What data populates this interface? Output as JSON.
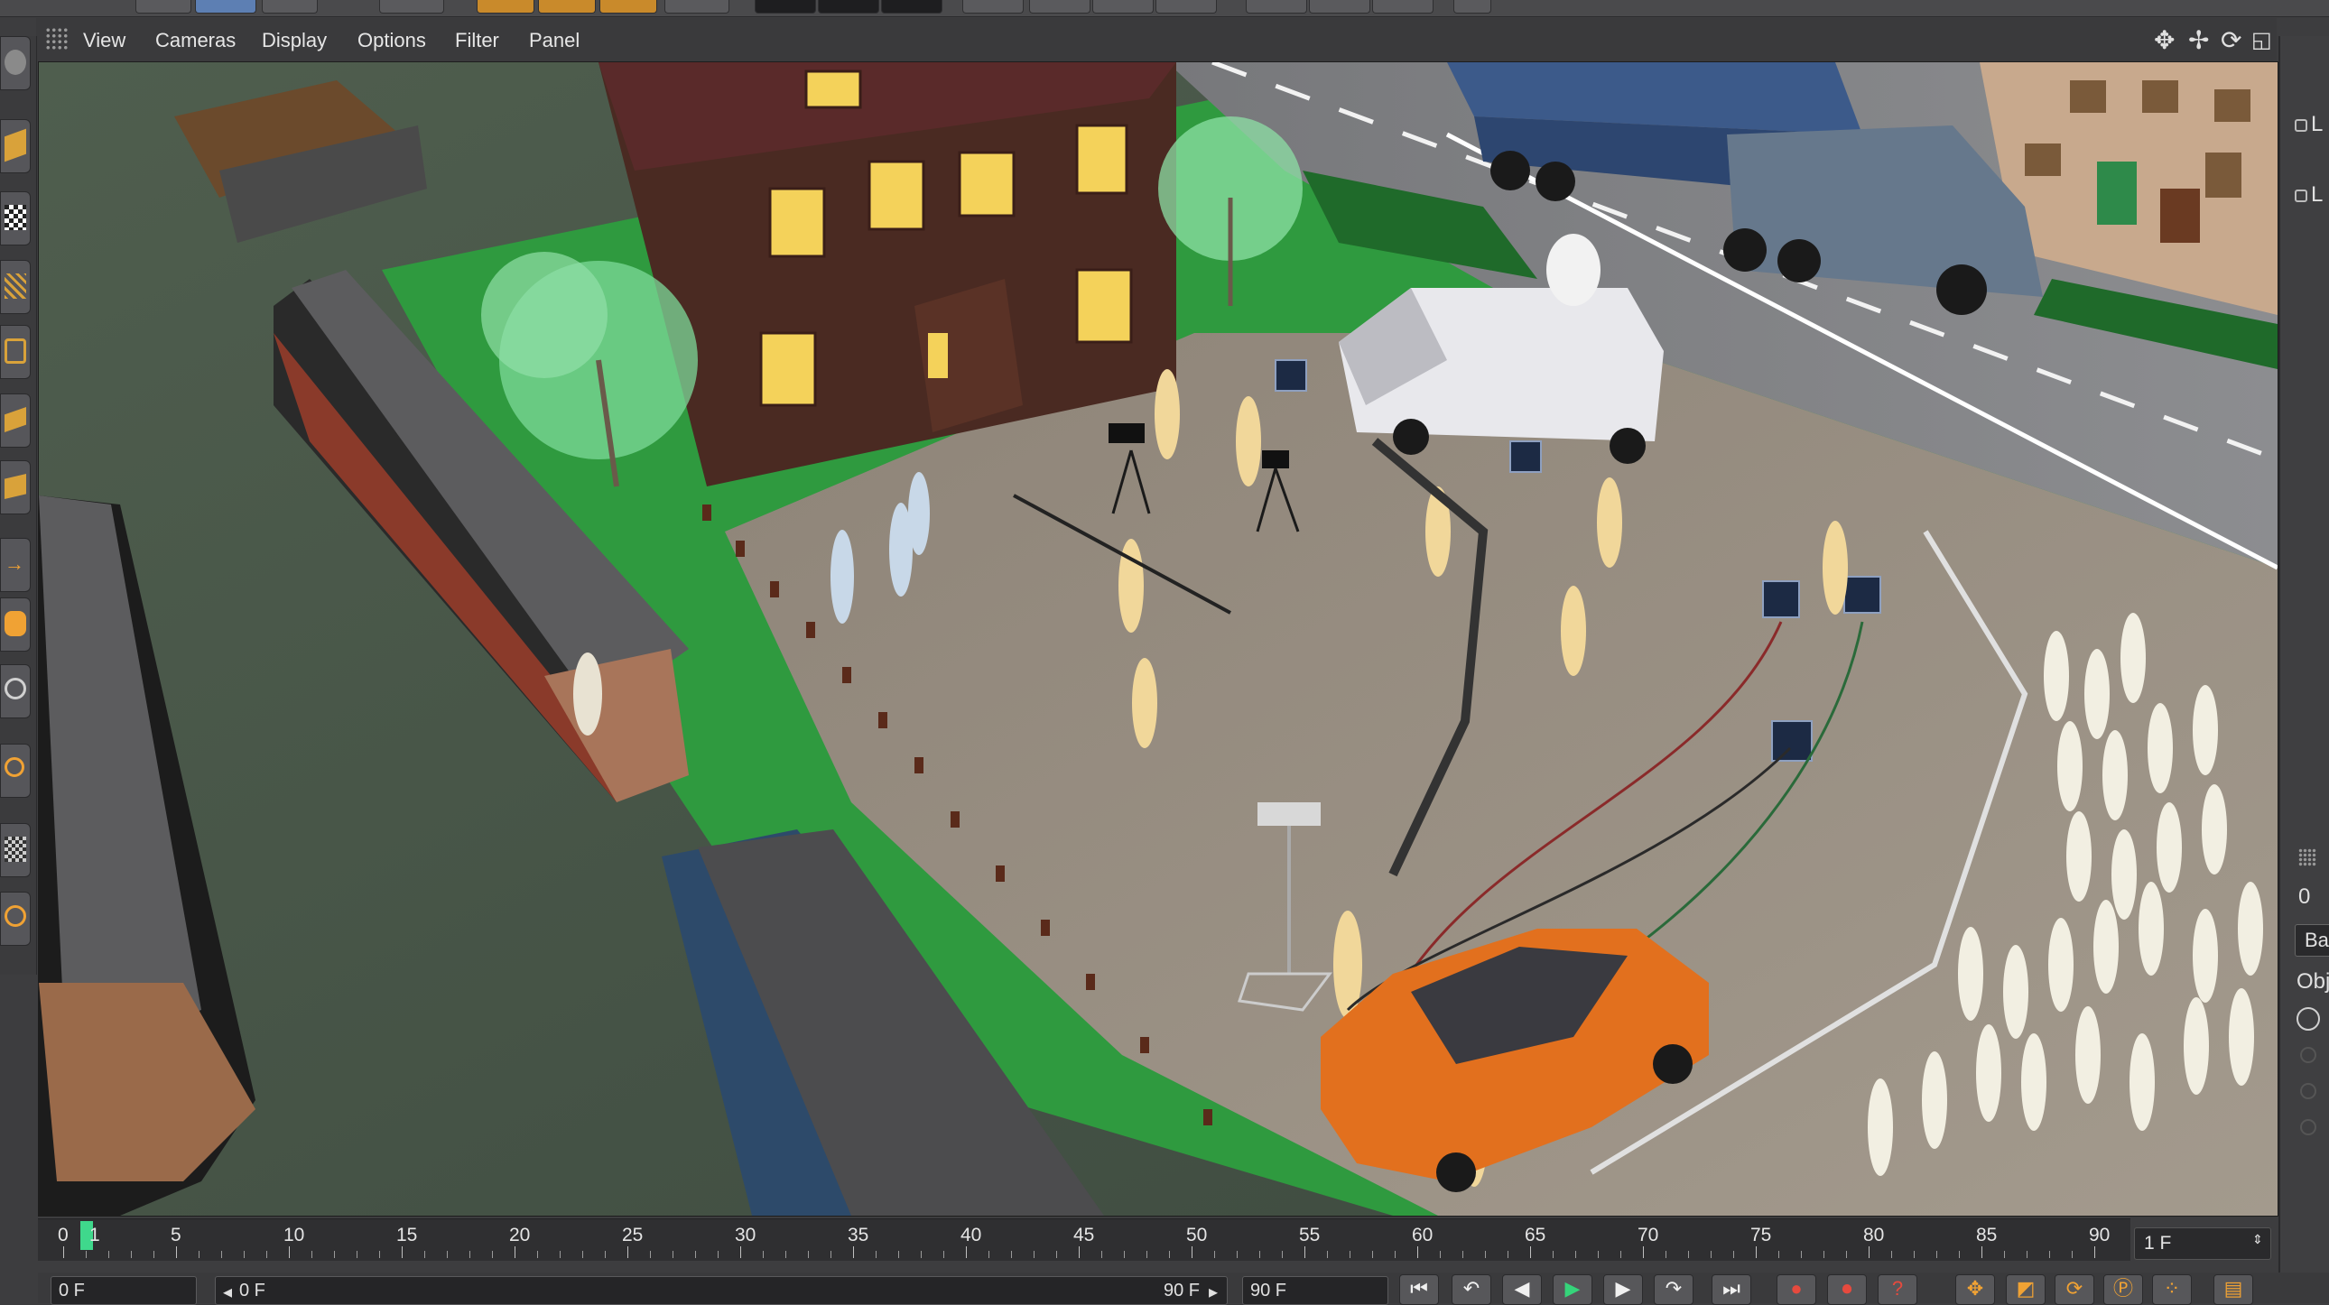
{
  "menu": {
    "items": [
      "View",
      "Cameras",
      "Display",
      "Options",
      "Filter",
      "Panel"
    ]
  },
  "timeline": {
    "labels": [
      "0",
      "1",
      "5",
      "10",
      "15",
      "20",
      "25",
      "30",
      "35",
      "40",
      "45",
      "50",
      "55",
      "60",
      "65",
      "70",
      "75",
      "80",
      "85",
      "90"
    ],
    "current_frame": 1
  },
  "frame_field": {
    "value": "1 F"
  },
  "bottom": {
    "start_field": "0 F",
    "range_start": "0 F",
    "range_end": "90 F",
    "end_field": "90 F"
  },
  "right_panel": {
    "labels": [
      "L",
      "L",
      "0",
      "Bas",
      "Obj"
    ]
  },
  "icons": {
    "nav": [
      "move-view-icon",
      "pan-view-icon",
      "rotate-view-icon",
      "maximize-view-icon"
    ],
    "playback": [
      "go-to-start-icon",
      "loop-back-icon",
      "step-back-icon",
      "play-icon",
      "step-forward-icon",
      "loop-forward-icon",
      "go-to-end-icon",
      "record-icon",
      "autokey-icon",
      "keyframe-help-icon",
      "move-key-icon",
      "scale-key-icon",
      "rotate-key-icon",
      "param-key-icon",
      "pla-key-icon",
      "timeline-window-icon"
    ]
  },
  "colors": {
    "accent_green": "#3fd88c",
    "record_red": "#e64a3e",
    "play_green": "#35d47a",
    "key_orange": "#f0a234"
  }
}
